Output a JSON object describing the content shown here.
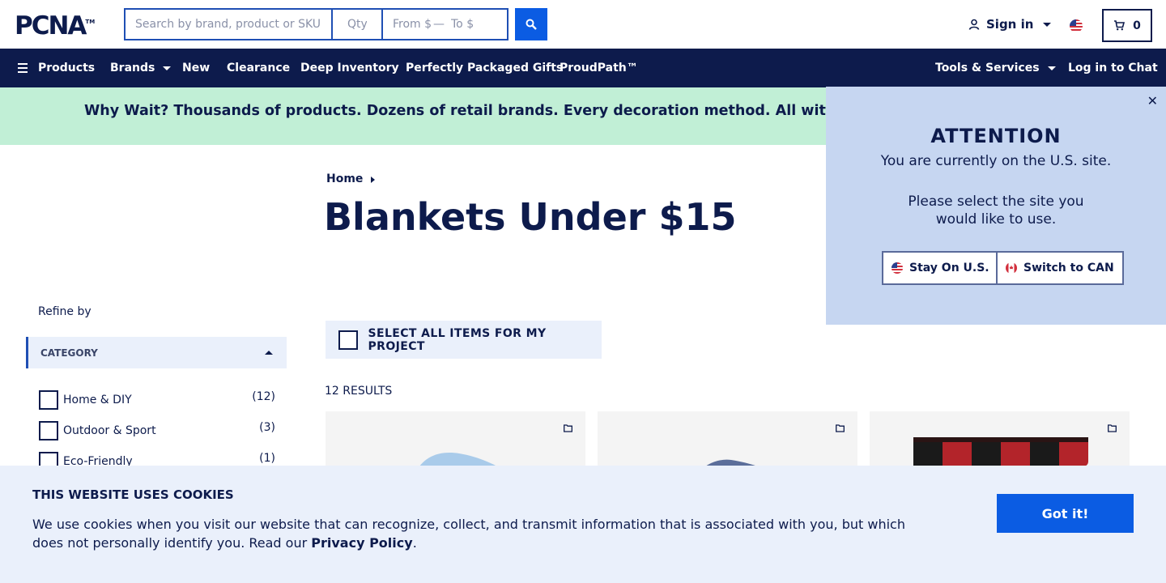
{
  "brand": {
    "logo_text": "PCNA",
    "logo_tm": "TM"
  },
  "search": {
    "placeholder": "Search by brand, product or SKU",
    "qty_placeholder": "Qty",
    "from_placeholder": "From $",
    "to_placeholder": "To $",
    "price_separator": "—"
  },
  "header": {
    "signin_label": "Sign in",
    "cart_count": "0"
  },
  "nav": {
    "products": "Products",
    "brands": "Brands",
    "new": "New",
    "clearance": "Clearance",
    "deep_inventory": "Deep Inventory",
    "gifts": "Perfectly Packaged Gifts",
    "proudpath": "ProudPath™",
    "tools": "Tools & Services",
    "chat": "Log in to Chat"
  },
  "promo": {
    "text": "Why Wait? Thousands of products. Dozens of retail brands. Every decoration method. All with a standard"
  },
  "breadcrumb": {
    "home": "Home"
  },
  "page": {
    "title": "Blankets Under $15"
  },
  "sidebar": {
    "refine_label": "Refine by",
    "category_header": "CATEGORY",
    "categories": [
      {
        "label": "Home & DIY",
        "count": "(12)"
      },
      {
        "label": "Outdoor & Sport",
        "count": "(3)"
      },
      {
        "label": "Eco-Friendly",
        "count": "(1)"
      }
    ]
  },
  "main": {
    "select_all_label": "SELECT ALL ITEMS FOR MY PROJECT",
    "results_label": "12 RESULTS"
  },
  "site_popup": {
    "close_glyph": "✕",
    "title": "ATTENTION",
    "line1": "You are currently on the U.S. site.",
    "line2": "Please select the site you",
    "line3": "would like to use.",
    "stay_label": "Stay On U.S.",
    "switch_label": "Switch to CAN"
  },
  "cookie": {
    "title": "THIS WEBSITE USES COOKIES",
    "text_before": "We use cookies when you visit our website that can recognize, collect, and transmit information that is associated with you, but which does not personally identify you. Read our ",
    "link": "Privacy Policy",
    "text_after": ".",
    "button": "Got it!"
  },
  "colors": {
    "navy": "#0d1b4c",
    "accent_blue": "#0b5ce3",
    "promo_green": "#c1efd6",
    "popup_blue": "#c6d6f1",
    "panel_light": "#eaf0fb"
  },
  "icons": [
    "search-icon",
    "user-icon",
    "us-flag-icon",
    "cart-icon",
    "hamburger-icon",
    "close-icon",
    "canada-flag-icon",
    "folder-icon"
  ]
}
